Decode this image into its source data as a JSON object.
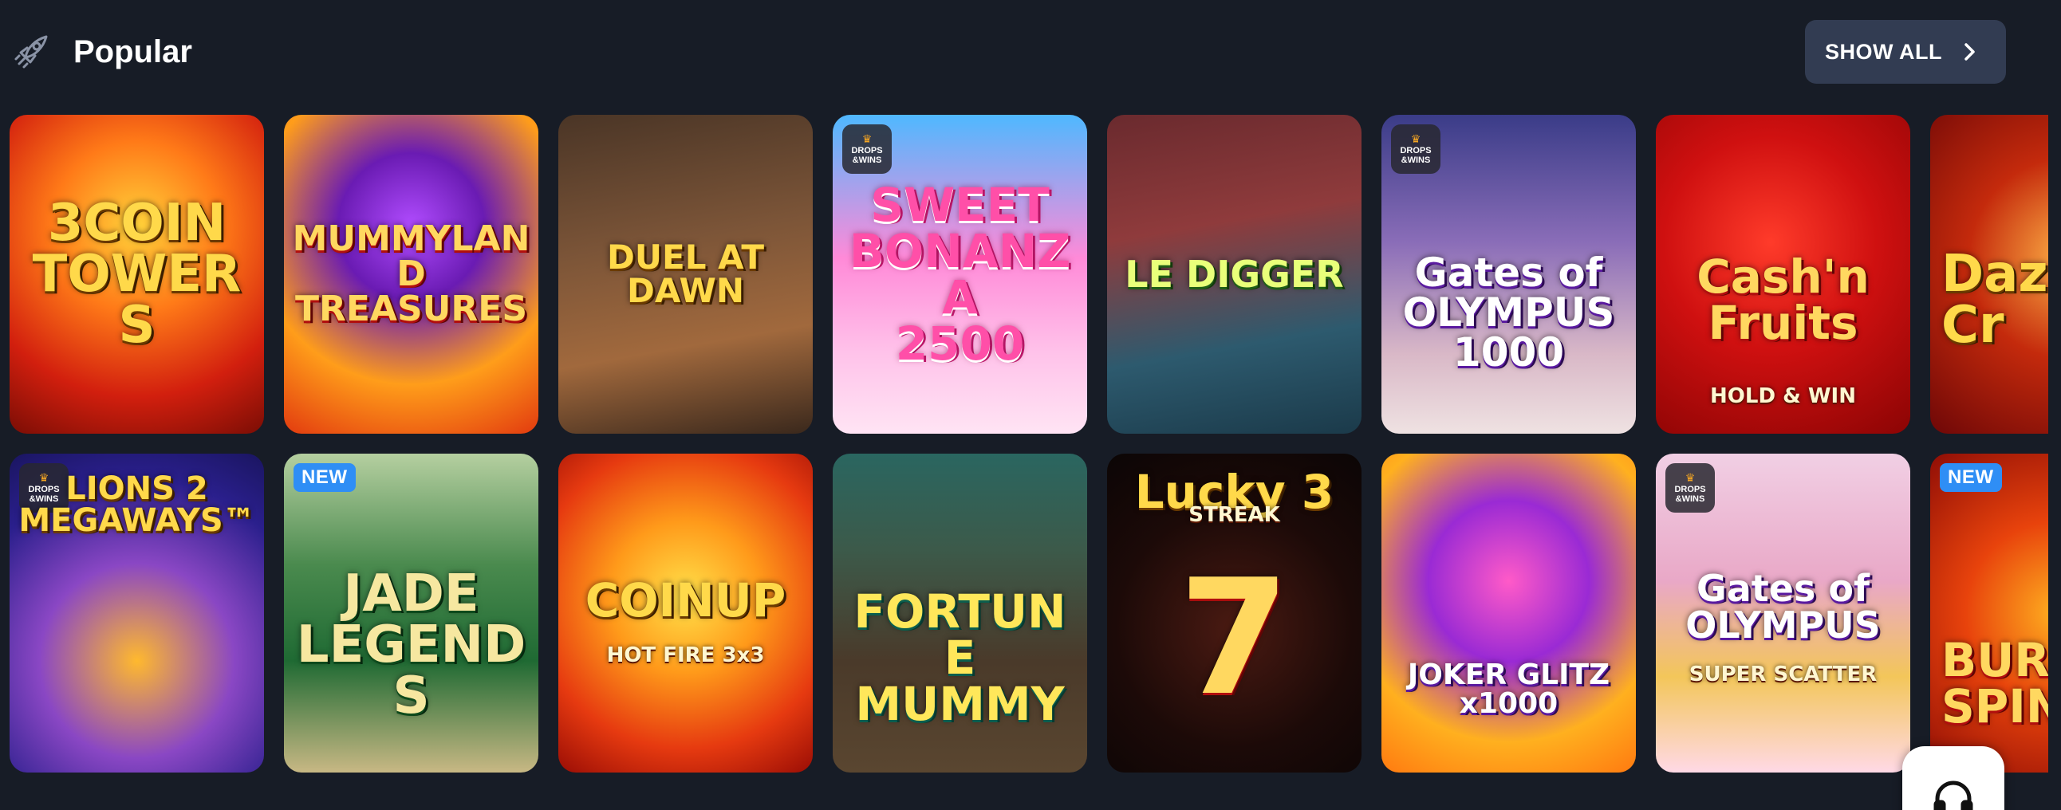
{
  "section": {
    "title": "Popular",
    "icon": "rocket-icon",
    "show_all_label": "SHOW ALL"
  },
  "badges": {
    "new": "NEW",
    "drops_wins_line1": "DROPS",
    "drops_wins_line2": "&WINS"
  },
  "games": [
    {
      "title": "3COIN\nTOWERS",
      "subtitle": "",
      "badge": ""
    },
    {
      "title": "MUMMYLAND\nTREASURES",
      "subtitle": "",
      "badge": ""
    },
    {
      "title": "DUEL AT DAWN",
      "subtitle": "",
      "badge": ""
    },
    {
      "title": "SWEET\nBONANZA\n2500",
      "subtitle": "",
      "badge": "drops-wins"
    },
    {
      "title": "LE DIGGER",
      "subtitle": "",
      "badge": ""
    },
    {
      "title": "Gates of\nOLYMPUS\n1000",
      "subtitle": "",
      "badge": "drops-wins"
    },
    {
      "title": "Cash'n\nFruits",
      "subtitle": "HOLD & WIN",
      "badge": ""
    },
    {
      "title": "Daz\nCr",
      "subtitle": "",
      "badge": ""
    },
    {
      "title": "LIONS 2\nMEGAWAYS™",
      "subtitle": "",
      "badge": "drops-wins"
    },
    {
      "title": "JADE\nLEGENDS",
      "subtitle": "",
      "badge": "new"
    },
    {
      "title": "COINUP",
      "subtitle": "HOT FIRE 3x3",
      "badge": ""
    },
    {
      "title": "FORTUNE\nMUMMY",
      "subtitle": "",
      "badge": ""
    },
    {
      "title": "Lucky 3",
      "subtitle": "STREAK",
      "badge": ""
    },
    {
      "title": "JOKER GLITZ\nx1000",
      "subtitle": "",
      "badge": ""
    },
    {
      "title": "Gates of\nOLYMPUS",
      "subtitle": "SUPER SCATTER",
      "badge": "drops-wins"
    },
    {
      "title": "BUR\nSPIN",
      "subtitle": "",
      "badge": "new"
    }
  ],
  "colors": {
    "page_background": "#171c26",
    "button_background": "#323c52",
    "new_badge": "#2f8ef5",
    "drops_wins_badge": "#282830"
  }
}
